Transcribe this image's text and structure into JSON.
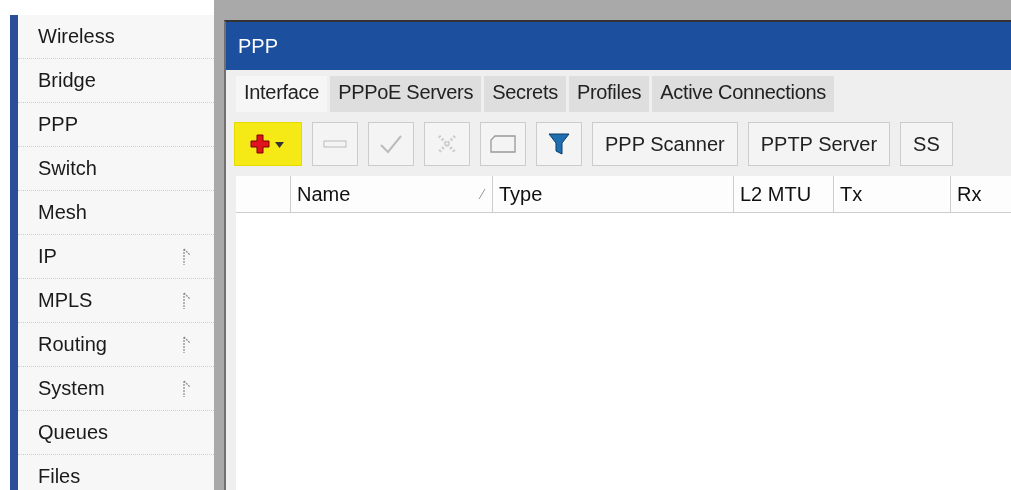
{
  "sidebar": {
    "items": [
      {
        "label": "Wireless",
        "has_submenu": false
      },
      {
        "label": "Bridge",
        "has_submenu": false
      },
      {
        "label": "PPP",
        "has_submenu": false
      },
      {
        "label": "Switch",
        "has_submenu": false
      },
      {
        "label": "Mesh",
        "has_submenu": false
      },
      {
        "label": "IP",
        "has_submenu": true
      },
      {
        "label": "MPLS",
        "has_submenu": true
      },
      {
        "label": "Routing",
        "has_submenu": true
      },
      {
        "label": "System",
        "has_submenu": true
      },
      {
        "label": "Queues",
        "has_submenu": false
      },
      {
        "label": "Files",
        "has_submenu": false
      }
    ]
  },
  "window": {
    "title": "PPP",
    "tabs": [
      {
        "label": "Interface",
        "selected": true
      },
      {
        "label": "PPPoE Servers",
        "selected": false
      },
      {
        "label": "Secrets",
        "selected": false
      },
      {
        "label": "Profiles",
        "selected": false
      },
      {
        "label": "Active Connections",
        "selected": false
      }
    ],
    "toolbar": [
      {
        "kind": "add",
        "highlighted": true
      },
      {
        "kind": "remove",
        "highlighted": false
      },
      {
        "kind": "enable",
        "highlighted": false
      },
      {
        "kind": "disable",
        "highlighted": false
      },
      {
        "kind": "comment",
        "highlighted": false
      },
      {
        "kind": "filter",
        "highlighted": false
      },
      {
        "kind": "text",
        "label": "PPP Scanner",
        "highlighted": false
      },
      {
        "kind": "text",
        "label": "PPTP Server",
        "highlighted": false
      },
      {
        "kind": "text",
        "label": "SS",
        "highlighted": false
      }
    ],
    "table": {
      "columns": [
        {
          "label": "Name",
          "sortable": true
        },
        {
          "label": "Type",
          "sortable": false
        },
        {
          "label": "L2 MTU",
          "sortable": false
        },
        {
          "label": "Tx",
          "sortable": false
        },
        {
          "label": "Rx",
          "sortable": false
        }
      ]
    }
  }
}
